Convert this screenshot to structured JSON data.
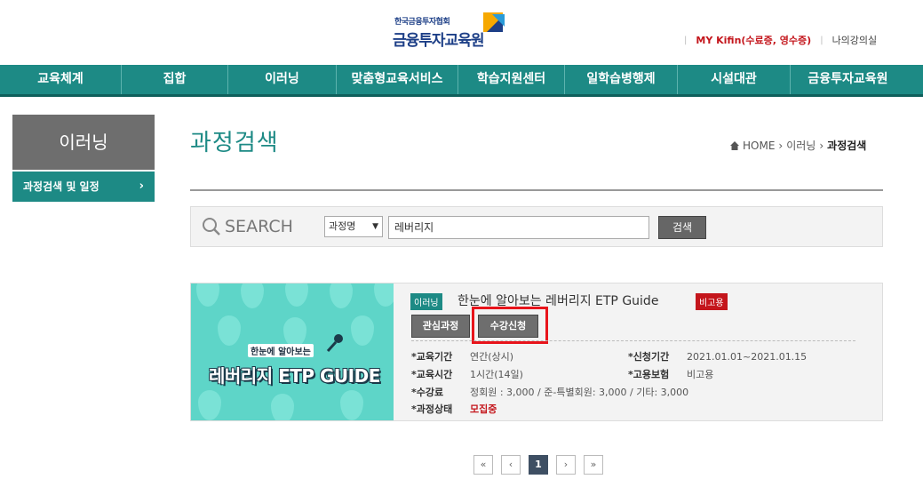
{
  "header": {
    "logo_small": "한국금융투자협회",
    "logo_big": "금융투자교육원",
    "my_kifin": "MY Kifin(수료증, 영수증)",
    "my_lecture": "나의강의실"
  },
  "gnb": [
    "교육체계",
    "집합",
    "이러닝",
    "맞춤형교육서비스",
    "학습지원센터",
    "일학습병행제",
    "시설대관",
    "금융투자교육원"
  ],
  "lnb": {
    "title": "이러닝",
    "item": "과정검색 및 일정"
  },
  "content": {
    "title": "과정검색",
    "breadcrumb": {
      "home": "HOME",
      "mid": "이러닝",
      "current": "과정검색"
    }
  },
  "search": {
    "label": "SEARCH",
    "select_value": "과정명",
    "query": "레버리지",
    "button": "검색"
  },
  "course": {
    "thumb_sub": "한눈에 알아보는",
    "thumb_main": "레버리지 ETP GUIDE",
    "type_badge": "이러닝",
    "title": "한눈에 알아보는 레버리지 ETP Guide",
    "insurance_badge": "비고용",
    "btn_favorite": "관심과정",
    "btn_apply": "수강신청",
    "info": {
      "edu_period_label": "*교육기간",
      "edu_period": "연간(상시)",
      "apply_period_label": "*신청기간",
      "apply_period": "2021.01.01~2021.01.15",
      "edu_time_label": "*교육시간",
      "edu_time": "1시간(14일)",
      "insurance_label": "*고용보험",
      "insurance": "비고용",
      "fee_label": "*수강료",
      "fee": "정회원 : 3,000 / 준-특별회원: 3,000 / 기타: 3,000",
      "status_label": "*과정상태",
      "status": "모집중"
    }
  },
  "pagination": {
    "first": "«",
    "prev": "‹",
    "current": "1",
    "next": "›",
    "last": "»"
  },
  "colors": {
    "brand_teal": "#1d8a85",
    "accent_red": "#c4161c",
    "highlight_red": "#e8141b"
  }
}
